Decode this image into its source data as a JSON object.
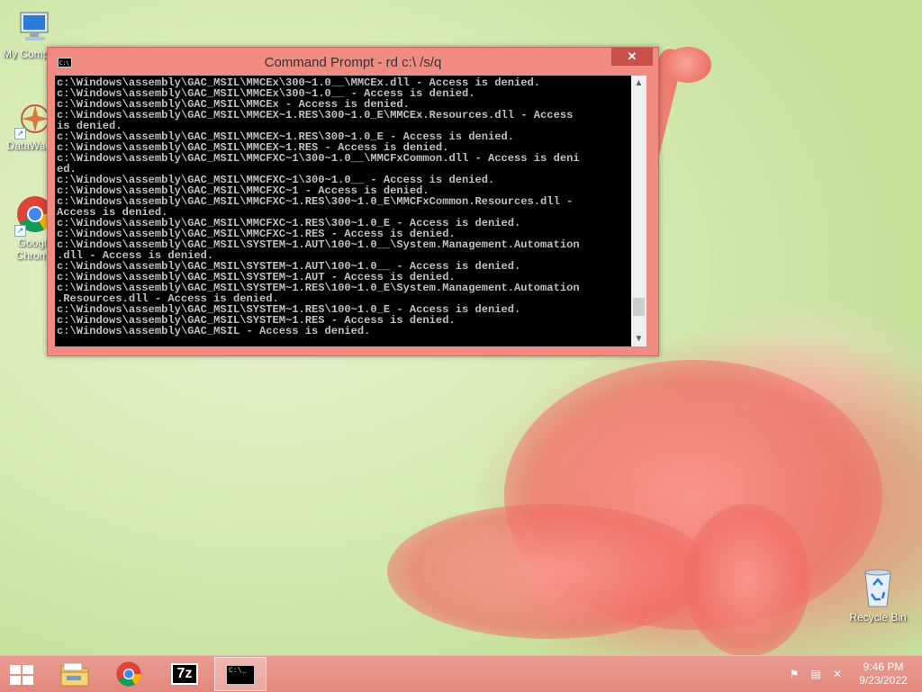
{
  "desktop": {
    "icons": [
      {
        "label": "My Computer",
        "icon": "computer-icon"
      },
      {
        "label": "DataWagon",
        "icon": "datawagon-icon"
      },
      {
        "label": "Google Chrome",
        "icon": "chrome-icon"
      },
      {
        "label": "Recycle Bin",
        "icon": "recycle-bin-icon"
      }
    ]
  },
  "window": {
    "title": "Command Prompt - rd  c:\\ /s/q",
    "close_label": "✕",
    "lines": [
      "c:\\Windows\\assembly\\GAC_MSIL\\MMCEx\\300~1.0__\\MMCEx.dll - Access is denied.",
      "c:\\Windows\\assembly\\GAC_MSIL\\MMCEx\\300~1.0__ - Access is denied.",
      "c:\\Windows\\assembly\\GAC_MSIL\\MMCEx - Access is denied.",
      "c:\\Windows\\assembly\\GAC_MSIL\\MMCEX~1.RES\\300~1.0_E\\MMCEx.Resources.dll - Access",
      "is denied.",
      "c:\\Windows\\assembly\\GAC_MSIL\\MMCEX~1.RES\\300~1.0_E - Access is denied.",
      "c:\\Windows\\assembly\\GAC_MSIL\\MMCEX~1.RES - Access is denied.",
      "c:\\Windows\\assembly\\GAC_MSIL\\MMCFXC~1\\300~1.0__\\MMCFxCommon.dll - Access is deni",
      "ed.",
      "c:\\Windows\\assembly\\GAC_MSIL\\MMCFXC~1\\300~1.0__ - Access is denied.",
      "c:\\Windows\\assembly\\GAC_MSIL\\MMCFXC~1 - Access is denied.",
      "c:\\Windows\\assembly\\GAC_MSIL\\MMCFXC~1.RES\\300~1.0_E\\MMCFxCommon.Resources.dll -",
      "Access is denied.",
      "c:\\Windows\\assembly\\GAC_MSIL\\MMCFXC~1.RES\\300~1.0_E - Access is denied.",
      "c:\\Windows\\assembly\\GAC_MSIL\\MMCFXC~1.RES - Access is denied.",
      "c:\\Windows\\assembly\\GAC_MSIL\\SYSTEM~1.AUT\\100~1.0__\\System.Management.Automation",
      ".dll - Access is denied.",
      "c:\\Windows\\assembly\\GAC_MSIL\\SYSTEM~1.AUT\\100~1.0__ - Access is denied.",
      "c:\\Windows\\assembly\\GAC_MSIL\\SYSTEM~1.AUT - Access is denied.",
      "c:\\Windows\\assembly\\GAC_MSIL\\SYSTEM~1.RES\\100~1.0_E\\System.Management.Automation",
      ".Resources.dll - Access is denied.",
      "c:\\Windows\\assembly\\GAC_MSIL\\SYSTEM~1.RES\\100~1.0_E - Access is denied.",
      "c:\\Windows\\assembly\\GAC_MSIL\\SYSTEM~1.RES - Access is denied.",
      "c:\\Windows\\assembly\\GAC_MSIL - Access is denied."
    ],
    "scroll_position": 0.93
  },
  "taskbar": {
    "pinned": [
      {
        "name": "file-explorer-icon"
      },
      {
        "name": "chrome-icon"
      },
      {
        "name": "7zip-icon",
        "label": "7z"
      },
      {
        "name": "command-prompt-icon",
        "label": "C:\\_",
        "active": true
      }
    ],
    "clock": {
      "time": "9:46 PM",
      "date": "9/23/2022"
    }
  },
  "colors": {
    "accent": "#f08b82",
    "taskbar": "#e3877d",
    "console_bg": "#000000",
    "console_fg": "#c0c0c0"
  }
}
